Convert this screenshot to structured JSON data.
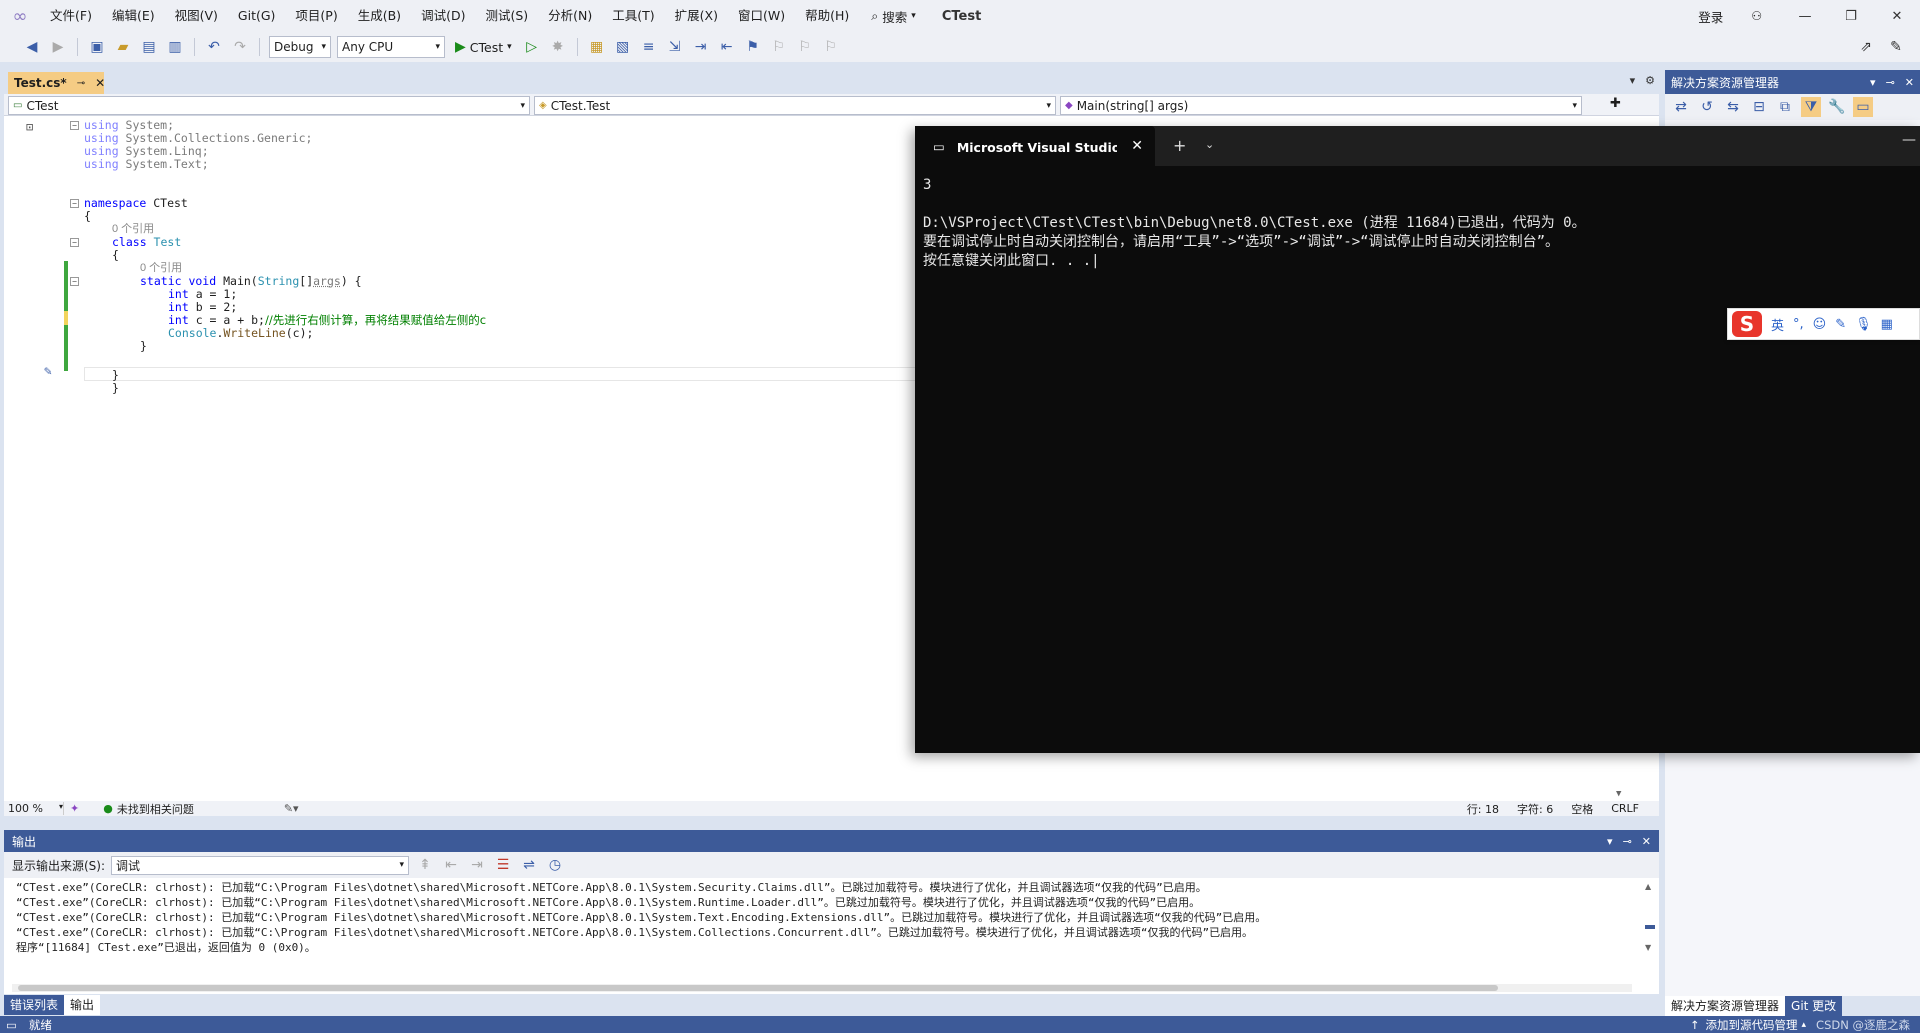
{
  "menubar": {
    "items": [
      "文件(F)",
      "编辑(E)",
      "视图(V)",
      "Git(G)",
      "项目(P)",
      "生成(B)",
      "调试(D)",
      "测试(S)",
      "分析(N)",
      "工具(T)",
      "扩展(X)",
      "窗口(W)",
      "帮助(H)"
    ],
    "search_label": "搜索",
    "app_title": "CTest",
    "login_label": "登录"
  },
  "toolbar": {
    "config": "Debug",
    "platform": "Any CPU",
    "run_label": "CTest"
  },
  "editor": {
    "tab_label": "Test.cs*",
    "nav_project": "CTest",
    "nav_class": "CTest.Test",
    "nav_member": "Main(string[] args)",
    "ref_class": "0 个引用",
    "ref_method": "0 个引用",
    "code": {
      "l1_kw": "using",
      "l1_rest": " System;",
      "l2_kw": "using",
      "l2_rest": " System.Collections.Generic;",
      "l3_kw": "using",
      "l3_rest": " System.Linq;",
      "l4_kw": "using",
      "l4_rest": " System.Text;",
      "ns_kw": "namespace",
      "ns_rest": " CTest",
      "ob1": "{",
      "cls_kw": "class",
      "cls_name": " Test",
      "ob2": "{",
      "m_kw": "static void",
      "m_name": " Main(",
      "m_type": "String",
      "m_arr": "[]",
      "m_arg": "args",
      "m_end": ") {",
      "a_kw": "int",
      "a_rest": " a = 1;",
      "b_kw": "int",
      "b_rest": " b = 2;",
      "c_kw": "int",
      "c_rest": " c = a + b;",
      "c_cm": "//先进行右侧计算，再将结果赋值给左侧的c",
      "w_type": "Console",
      "w_dot": ".",
      "w_meth": "WriteLine",
      "w_rest": "(c);",
      "cb1": "}",
      "cb2": "}",
      "cb3": "}"
    },
    "status": {
      "zoom": "100 %",
      "issues": "未找到相关问题",
      "line": "行: 18",
      "char": "字符: 6",
      "space": "空格",
      "eol": "CRLF"
    }
  },
  "solution_explorer": {
    "title": "解决方案资源管理器",
    "tab_solution": "解决方案资源管理器",
    "tab_git": "Git 更改"
  },
  "console": {
    "tab_title": "Microsoft Visual Studio 调试控",
    "lines": [
      "3",
      "",
      "D:\\VSProject\\CTest\\CTest\\bin\\Debug\\net8.0\\CTest.exe (进程 11684)已退出，代码为 0。",
      "要在调试停止时自动关闭控制台，请启用“工具”->“选项”->“调试”->“调试停止时自动关闭控制台”。",
      "按任意键关闭此窗口. . .|"
    ]
  },
  "ime": {
    "logo": "S",
    "lang": "英"
  },
  "output": {
    "title": "输出",
    "source_label": "显示输出来源(S):",
    "source_value": "调试",
    "lines": [
      "“CTest.exe”(CoreCLR: clrhost): 已加载“C:\\Program Files\\dotnet\\shared\\Microsoft.NETCore.App\\8.0.1\\System.Security.Claims.dll”。已跳过加载符号。模块进行了优化，并且调试器选项“仅我的代码”已启用。",
      "“CTest.exe”(CoreCLR: clrhost): 已加载“C:\\Program Files\\dotnet\\shared\\Microsoft.NETCore.App\\8.0.1\\System.Runtime.Loader.dll”。已跳过加载符号。模块进行了优化，并且调试器选项“仅我的代码”已启用。",
      "“CTest.exe”(CoreCLR: clrhost): 已加载“C:\\Program Files\\dotnet\\shared\\Microsoft.NETCore.App\\8.0.1\\System.Text.Encoding.Extensions.dll”。已跳过加载符号。模块进行了优化，并且调试器选项“仅我的代码”已启用。",
      "“CTest.exe”(CoreCLR: clrhost): 已加载“C:\\Program Files\\dotnet\\shared\\Microsoft.NETCore.App\\8.0.1\\System.Collections.Concurrent.dll”。已跳过加载符号。模块进行了优化，并且调试器选项“仅我的代码”已启用。",
      "程序“[11684] CTest.exe”已退出，返回值为 0 (0x0)。"
    ],
    "tab_errors": "错误列表",
    "tab_output": "输出"
  },
  "statusbar": {
    "ready": "就绪",
    "source_control": "添加到源代码管理",
    "watermark": "CSDN @逐鹿之森"
  }
}
